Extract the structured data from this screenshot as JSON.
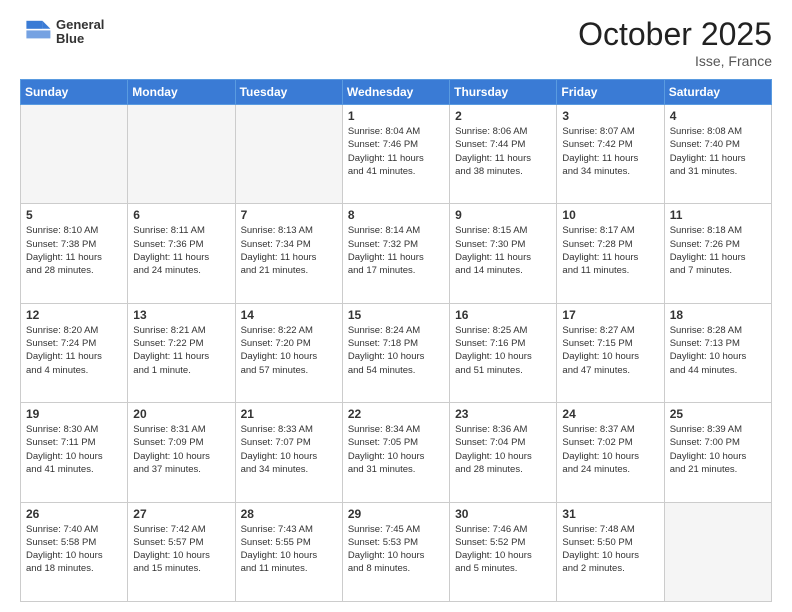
{
  "header": {
    "logo_line1": "General",
    "logo_line2": "Blue",
    "month": "October 2025",
    "location": "Isse, France"
  },
  "weekdays": [
    "Sunday",
    "Monday",
    "Tuesday",
    "Wednesday",
    "Thursday",
    "Friday",
    "Saturday"
  ],
  "weeks": [
    [
      {
        "day": "",
        "info": ""
      },
      {
        "day": "",
        "info": ""
      },
      {
        "day": "",
        "info": ""
      },
      {
        "day": "1",
        "info": "Sunrise: 8:04 AM\nSunset: 7:46 PM\nDaylight: 11 hours\nand 41 minutes."
      },
      {
        "day": "2",
        "info": "Sunrise: 8:06 AM\nSunset: 7:44 PM\nDaylight: 11 hours\nand 38 minutes."
      },
      {
        "day": "3",
        "info": "Sunrise: 8:07 AM\nSunset: 7:42 PM\nDaylight: 11 hours\nand 34 minutes."
      },
      {
        "day": "4",
        "info": "Sunrise: 8:08 AM\nSunset: 7:40 PM\nDaylight: 11 hours\nand 31 minutes."
      }
    ],
    [
      {
        "day": "5",
        "info": "Sunrise: 8:10 AM\nSunset: 7:38 PM\nDaylight: 11 hours\nand 28 minutes."
      },
      {
        "day": "6",
        "info": "Sunrise: 8:11 AM\nSunset: 7:36 PM\nDaylight: 11 hours\nand 24 minutes."
      },
      {
        "day": "7",
        "info": "Sunrise: 8:13 AM\nSunset: 7:34 PM\nDaylight: 11 hours\nand 21 minutes."
      },
      {
        "day": "8",
        "info": "Sunrise: 8:14 AM\nSunset: 7:32 PM\nDaylight: 11 hours\nand 17 minutes."
      },
      {
        "day": "9",
        "info": "Sunrise: 8:15 AM\nSunset: 7:30 PM\nDaylight: 11 hours\nand 14 minutes."
      },
      {
        "day": "10",
        "info": "Sunrise: 8:17 AM\nSunset: 7:28 PM\nDaylight: 11 hours\nand 11 minutes."
      },
      {
        "day": "11",
        "info": "Sunrise: 8:18 AM\nSunset: 7:26 PM\nDaylight: 11 hours\nand 7 minutes."
      }
    ],
    [
      {
        "day": "12",
        "info": "Sunrise: 8:20 AM\nSunset: 7:24 PM\nDaylight: 11 hours\nand 4 minutes."
      },
      {
        "day": "13",
        "info": "Sunrise: 8:21 AM\nSunset: 7:22 PM\nDaylight: 11 hours\nand 1 minute."
      },
      {
        "day": "14",
        "info": "Sunrise: 8:22 AM\nSunset: 7:20 PM\nDaylight: 10 hours\nand 57 minutes."
      },
      {
        "day": "15",
        "info": "Sunrise: 8:24 AM\nSunset: 7:18 PM\nDaylight: 10 hours\nand 54 minutes."
      },
      {
        "day": "16",
        "info": "Sunrise: 8:25 AM\nSunset: 7:16 PM\nDaylight: 10 hours\nand 51 minutes."
      },
      {
        "day": "17",
        "info": "Sunrise: 8:27 AM\nSunset: 7:15 PM\nDaylight: 10 hours\nand 47 minutes."
      },
      {
        "day": "18",
        "info": "Sunrise: 8:28 AM\nSunset: 7:13 PM\nDaylight: 10 hours\nand 44 minutes."
      }
    ],
    [
      {
        "day": "19",
        "info": "Sunrise: 8:30 AM\nSunset: 7:11 PM\nDaylight: 10 hours\nand 41 minutes."
      },
      {
        "day": "20",
        "info": "Sunrise: 8:31 AM\nSunset: 7:09 PM\nDaylight: 10 hours\nand 37 minutes."
      },
      {
        "day": "21",
        "info": "Sunrise: 8:33 AM\nSunset: 7:07 PM\nDaylight: 10 hours\nand 34 minutes."
      },
      {
        "day": "22",
        "info": "Sunrise: 8:34 AM\nSunset: 7:05 PM\nDaylight: 10 hours\nand 31 minutes."
      },
      {
        "day": "23",
        "info": "Sunrise: 8:36 AM\nSunset: 7:04 PM\nDaylight: 10 hours\nand 28 minutes."
      },
      {
        "day": "24",
        "info": "Sunrise: 8:37 AM\nSunset: 7:02 PM\nDaylight: 10 hours\nand 24 minutes."
      },
      {
        "day": "25",
        "info": "Sunrise: 8:39 AM\nSunset: 7:00 PM\nDaylight: 10 hours\nand 21 minutes."
      }
    ],
    [
      {
        "day": "26",
        "info": "Sunrise: 7:40 AM\nSunset: 5:58 PM\nDaylight: 10 hours\nand 18 minutes."
      },
      {
        "day": "27",
        "info": "Sunrise: 7:42 AM\nSunset: 5:57 PM\nDaylight: 10 hours\nand 15 minutes."
      },
      {
        "day": "28",
        "info": "Sunrise: 7:43 AM\nSunset: 5:55 PM\nDaylight: 10 hours\nand 11 minutes."
      },
      {
        "day": "29",
        "info": "Sunrise: 7:45 AM\nSunset: 5:53 PM\nDaylight: 10 hours\nand 8 minutes."
      },
      {
        "day": "30",
        "info": "Sunrise: 7:46 AM\nSunset: 5:52 PM\nDaylight: 10 hours\nand 5 minutes."
      },
      {
        "day": "31",
        "info": "Sunrise: 7:48 AM\nSunset: 5:50 PM\nDaylight: 10 hours\nand 2 minutes."
      },
      {
        "day": "",
        "info": ""
      }
    ]
  ]
}
